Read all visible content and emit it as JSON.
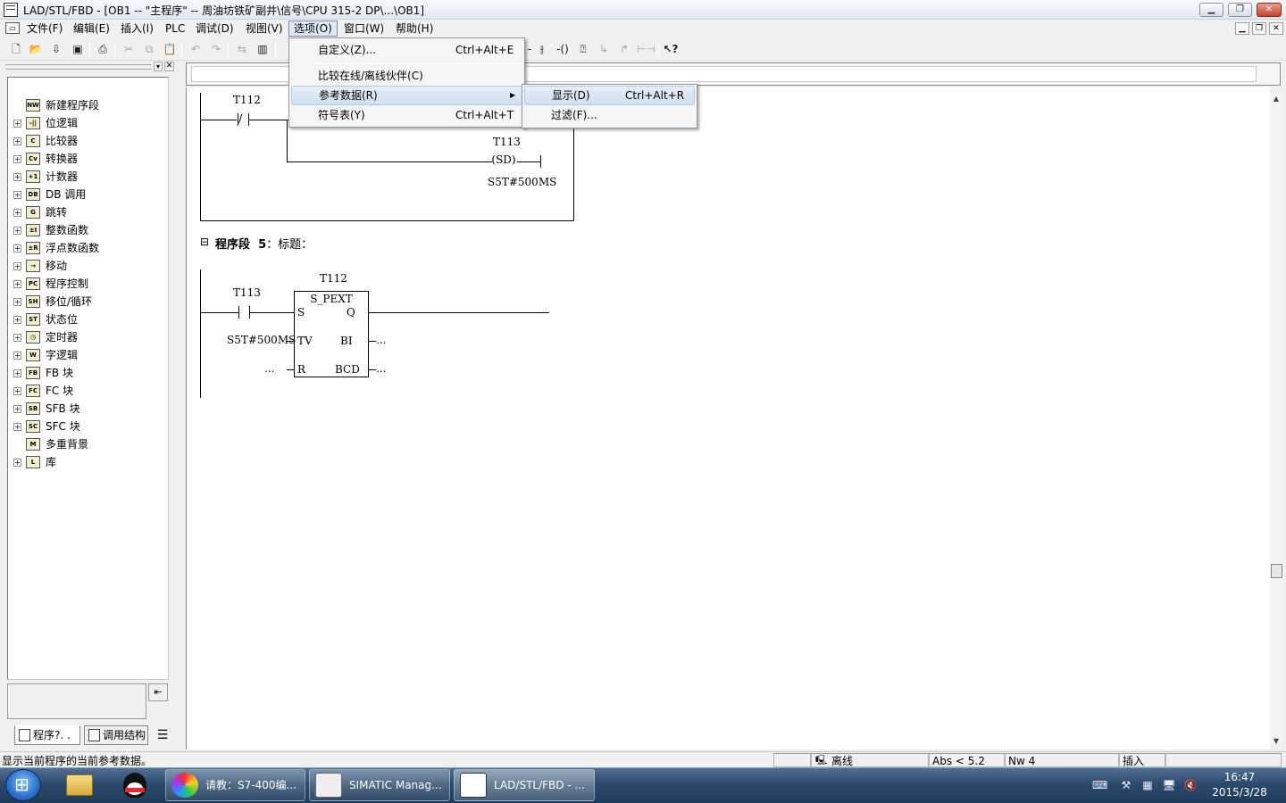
{
  "window": {
    "title": "LAD/STL/FBD  - [OB1 -- \"主程序\" -- 周油坊铁矿副井\\信号\\CPU 315-2 DP\\...\\OB1]",
    "minimize": "▁",
    "restore": "❐",
    "close": "✕"
  },
  "menubar": {
    "items": [
      "文件(F)",
      "编辑(E)",
      "插入(I)",
      "PLC",
      "调试(D)",
      "视图(V)",
      "选项(O)",
      "窗口(W)",
      "帮助(H)"
    ],
    "open_index": 6
  },
  "toolbar": {
    "icons": [
      "new-icon",
      "open-icon",
      "download-icon",
      "save-icon",
      "print-icon",
      "cut-icon",
      "copy-icon",
      "paste-icon",
      "undo-icon",
      "redo-icon",
      "monitor-icon",
      "module-icon"
    ],
    "right_icons": [
      "nc-contact-icon",
      "coil-icon",
      "box-icon",
      "branch-open-icon",
      "branch-close-icon",
      "connection-icon",
      "help-icon"
    ]
  },
  "program_elements": {
    "items": [
      {
        "label": "新建程序段",
        "icon": "new-network-icon",
        "icon_text": "NW",
        "expandable": false
      },
      {
        "label": "位逻辑",
        "icon": "bit-logic-icon",
        "icon_text": "-||",
        "expandable": true
      },
      {
        "label": "比较器",
        "icon": "comparator-icon",
        "icon_text": "C",
        "expandable": true
      },
      {
        "label": "转换器",
        "icon": "converter-icon",
        "icon_text": "Cv",
        "expandable": true
      },
      {
        "label": "计数器",
        "icon": "counter-icon",
        "icon_text": "+1",
        "expandable": true
      },
      {
        "label": "DB 调用",
        "icon": "db-call-icon",
        "icon_text": "DB",
        "expandable": true
      },
      {
        "label": "跳转",
        "icon": "jump-icon",
        "icon_text": "G",
        "expandable": true
      },
      {
        "label": "整数函数",
        "icon": "integer-math-icon",
        "icon_text": "±I",
        "expandable": true
      },
      {
        "label": "浮点数函数",
        "icon": "float-math-icon",
        "icon_text": "±R",
        "expandable": true
      },
      {
        "label": "移动",
        "icon": "move-icon",
        "icon_text": "→",
        "expandable": true
      },
      {
        "label": "程序控制",
        "icon": "program-control-icon",
        "icon_text": "PC",
        "expandable": true
      },
      {
        "label": "移位/循环",
        "icon": "shift-rotate-icon",
        "icon_text": "SH",
        "expandable": true
      },
      {
        "label": "状态位",
        "icon": "status-bit-icon",
        "icon_text": "ST",
        "expandable": true
      },
      {
        "label": "定时器",
        "icon": "timer-icon",
        "icon_text": "◷",
        "expandable": true
      },
      {
        "label": "字逻辑",
        "icon": "word-logic-icon",
        "icon_text": "W",
        "expandable": true
      },
      {
        "label": "FB 块",
        "icon": "fb-block-icon",
        "icon_text": "FB",
        "expandable": true
      },
      {
        "label": "FC 块",
        "icon": "fc-block-icon",
        "icon_text": "FC",
        "expandable": true
      },
      {
        "label": "SFB 块",
        "icon": "sfb-block-icon",
        "icon_text": "SB",
        "expandable": true
      },
      {
        "label": "SFC 块",
        "icon": "sfc-block-icon",
        "icon_text": "SC",
        "expandable": true
      },
      {
        "label": "多重背景",
        "icon": "multi-instance-icon",
        "icon_text": "M",
        "expandable": false
      },
      {
        "label": "库",
        "icon": "library-icon",
        "icon_text": "L",
        "expandable": true
      }
    ],
    "tabs": [
      "程序?. .",
      "调用结构"
    ],
    "bottom_button": "⇤"
  },
  "editor": {
    "network4": {
      "contact_label": "T112",
      "coil_label": "T113",
      "coil_type": "SD",
      "coil_value": "S5T#500MS"
    },
    "network5": {
      "collapse": "⊟",
      "title_prefix": "程序段",
      "number": "5",
      "title_suffix": "：标题：",
      "contact_label": "T113",
      "box_label": "T112",
      "box_type": "S_PEXT",
      "pins": {
        "s": "S",
        "q": "Q",
        "tv": "TV",
        "bi": "BI",
        "r": "R",
        "bcd": "BCD"
      },
      "tv_value": "S5T#500MS",
      "r_value": "...",
      "bi_value": "...",
      "bcd_value": "..."
    }
  },
  "options_menu": {
    "items": [
      {
        "label": "自定义(Z)...",
        "shortcut": "Ctrl+Alt+E"
      },
      {
        "label": "比较在线/离线伙伴(C)",
        "shortcut": ""
      },
      {
        "label": "参考数据(R)",
        "shortcut": "",
        "submenu": true
      },
      {
        "label": "符号表(Y)",
        "shortcut": "Ctrl+Alt+T"
      }
    ],
    "submenu_arrow": "▶"
  },
  "reference_submenu": {
    "items": [
      {
        "label": "显示(D)",
        "shortcut": "Ctrl+Alt+R"
      },
      {
        "label": "过滤(F)...",
        "shortcut": ""
      }
    ]
  },
  "statusbar": {
    "message": "显示当前程序的当前参考数据。",
    "mode": "离线",
    "address": "Abs < 5.2",
    "network": "Nw 4",
    "insert": "插入"
  },
  "taskbar": {
    "tasks": [
      {
        "label": "请教：S7-400编..."
      },
      {
        "label": "SIMATIC Manag..."
      },
      {
        "label": "LAD/STL/FBD  - ..."
      }
    ],
    "time": "16:47",
    "date": "2015/3/28"
  }
}
